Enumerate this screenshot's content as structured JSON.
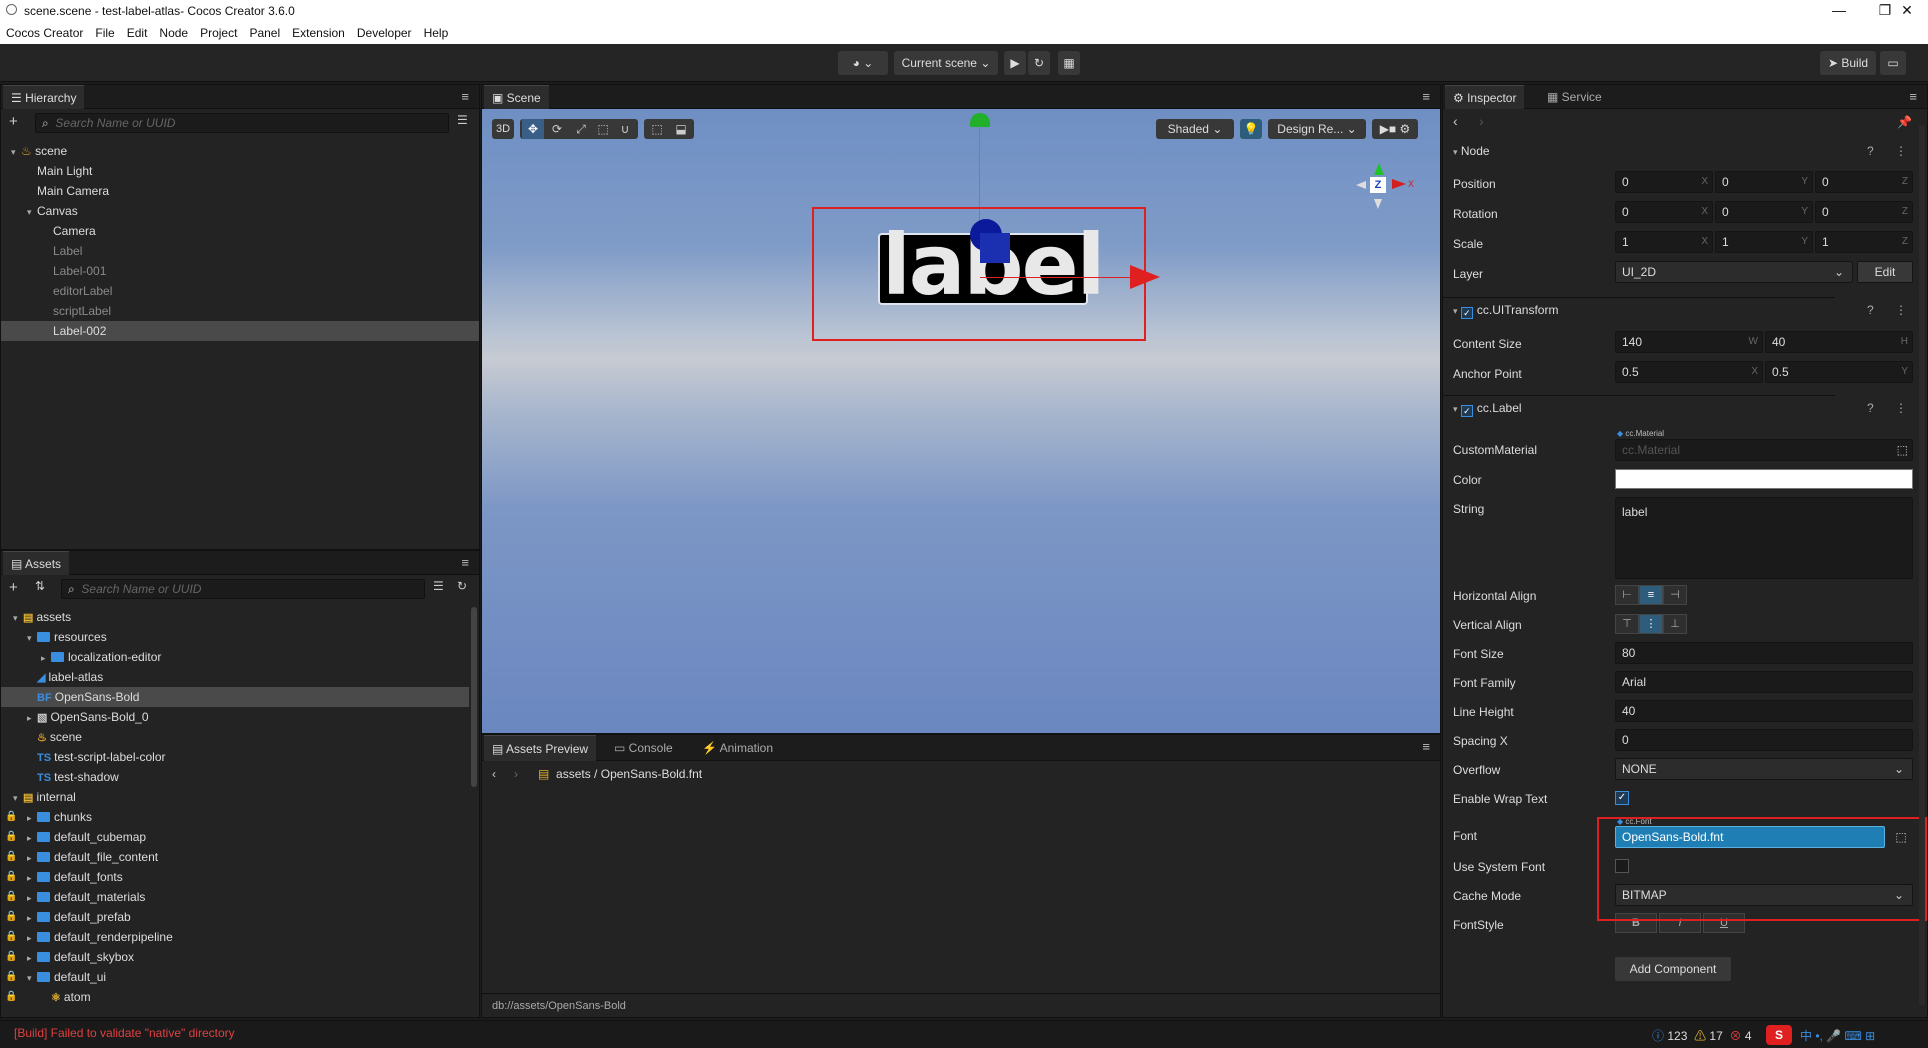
{
  "window": {
    "title": "scene.scene - test-label-atlas- Cocos Creator 3.6.0"
  },
  "menu": [
    "Cocos Creator",
    "File",
    "Edit",
    "Node",
    "Project",
    "Panel",
    "Extension",
    "Developer",
    "Help"
  ],
  "toolbar": {
    "scene_select": "Current scene",
    "build": "Build"
  },
  "hierarchy": {
    "tab": "Hierarchy",
    "search_placeholder": "Search Name or UUID",
    "items": [
      {
        "label": "scene",
        "depth": 0,
        "arrow": "open",
        "icon": "fire",
        "dim": false,
        "sel": false
      },
      {
        "label": "Main Light",
        "depth": 1,
        "arrow": "",
        "icon": "",
        "dim": false,
        "sel": false
      },
      {
        "label": "Main Camera",
        "depth": 1,
        "arrow": "",
        "icon": "",
        "dim": false,
        "sel": false
      },
      {
        "label": "Canvas",
        "depth": 1,
        "arrow": "open",
        "icon": "",
        "dim": false,
        "sel": false
      },
      {
        "label": "Camera",
        "depth": 2,
        "arrow": "",
        "icon": "",
        "dim": false,
        "sel": false
      },
      {
        "label": "Label",
        "depth": 2,
        "arrow": "",
        "icon": "",
        "dim": true,
        "sel": false
      },
      {
        "label": "Label-001",
        "depth": 2,
        "arrow": "",
        "icon": "",
        "dim": true,
        "sel": false
      },
      {
        "label": "editorLabel",
        "depth": 2,
        "arrow": "",
        "icon": "",
        "dim": true,
        "sel": false
      },
      {
        "label": "scriptLabel",
        "depth": 2,
        "arrow": "",
        "icon": "",
        "dim": true,
        "sel": false
      },
      {
        "label": "Label-002",
        "depth": 2,
        "arrow": "",
        "icon": "",
        "dim": false,
        "sel": true
      }
    ]
  },
  "assets": {
    "tab": "Assets",
    "search_placeholder": "Search Name or UUID",
    "items": [
      {
        "label": "assets",
        "depth": 0,
        "arrow": "open",
        "icon": "db",
        "lock": false,
        "sel": false
      },
      {
        "label": "resources",
        "depth": 1,
        "arrow": "open",
        "icon": "folder",
        "lock": false,
        "sel": false
      },
      {
        "label": "localization-editor",
        "depth": 2,
        "arrow": "closed",
        "icon": "folder",
        "lock": false,
        "sel": false
      },
      {
        "label": "label-atlas",
        "depth": 1,
        "arrow": "",
        "icon": "labelatlas",
        "lock": false,
        "sel": false
      },
      {
        "label": "OpenSans-Bold",
        "depth": 1,
        "arrow": "",
        "icon": "bf",
        "lock": false,
        "sel": true
      },
      {
        "label": "OpenSans-Bold_0",
        "depth": 1,
        "arrow": "closed",
        "icon": "img",
        "lock": false,
        "sel": false
      },
      {
        "label": "scene",
        "depth": 1,
        "arrow": "",
        "icon": "fire",
        "lock": false,
        "sel": false
      },
      {
        "label": "test-script-label-color",
        "depth": 1,
        "arrow": "",
        "icon": "ts",
        "lock": false,
        "sel": false
      },
      {
        "label": "test-shadow",
        "depth": 1,
        "arrow": "",
        "icon": "ts",
        "lock": false,
        "sel": false
      },
      {
        "label": "internal",
        "depth": 0,
        "arrow": "open",
        "icon": "db",
        "lock": false,
        "sel": false
      },
      {
        "label": "chunks",
        "depth": 1,
        "arrow": "closed",
        "icon": "folder",
        "lock": true,
        "sel": false
      },
      {
        "label": "default_cubemap",
        "depth": 1,
        "arrow": "closed",
        "icon": "folder",
        "lock": true,
        "sel": false
      },
      {
        "label": "default_file_content",
        "depth": 1,
        "arrow": "closed",
        "icon": "folder",
        "lock": true,
        "sel": false
      },
      {
        "label": "default_fonts",
        "depth": 1,
        "arrow": "closed",
        "icon": "folder",
        "lock": true,
        "sel": false
      },
      {
        "label": "default_materials",
        "depth": 1,
        "arrow": "closed",
        "icon": "folder",
        "lock": true,
        "sel": false
      },
      {
        "label": "default_prefab",
        "depth": 1,
        "arrow": "closed",
        "icon": "folder",
        "lock": true,
        "sel": false
      },
      {
        "label": "default_renderpipeline",
        "depth": 1,
        "arrow": "closed",
        "icon": "folder",
        "lock": true,
        "sel": false
      },
      {
        "label": "default_skybox",
        "depth": 1,
        "arrow": "closed",
        "icon": "folder",
        "lock": true,
        "sel": false
      },
      {
        "label": "default_ui",
        "depth": 1,
        "arrow": "open",
        "icon": "folder",
        "lock": true,
        "sel": false
      },
      {
        "label": "atom",
        "depth": 2,
        "arrow": "",
        "icon": "atom",
        "lock": true,
        "sel": false
      }
    ]
  },
  "scene": {
    "tab": "Scene",
    "mode3d": "3D",
    "shading": "Shaded",
    "design": "Design Re...",
    "label_text": "label",
    "gizmo_z": "Z"
  },
  "bottom": {
    "tabs": [
      "Assets Preview",
      "Console",
      "Animation"
    ],
    "breadcrumb_root": "assets",
    "breadcrumb_sep": "/",
    "breadcrumb_file": "OpenSans-Bold.fnt",
    "footer": "db://assets/OpenSans-Bold"
  },
  "inspector": {
    "tabs": [
      "Inspector",
      "Service"
    ],
    "node": {
      "title": "Node",
      "position": [
        "0",
        "0",
        "0"
      ],
      "rotation": [
        "0",
        "0",
        "0"
      ],
      "scale": [
        "1",
        "1",
        "1"
      ],
      "layer": "UI_2D",
      "edit": "Edit",
      "labels": {
        "position": "Position",
        "rotation": "Rotation",
        "scale": "Scale",
        "layer": "Layer"
      }
    },
    "axes": {
      "x": "X",
      "y": "Y",
      "z": "Z",
      "w": "W",
      "h": "H"
    },
    "uitransform": {
      "title": "cc.UITransform",
      "content_label": "Content Size",
      "content": [
        "140",
        "40"
      ],
      "anchor_label": "Anchor Point",
      "anchor": [
        "0.5",
        "0.5"
      ]
    },
    "label": {
      "title": "cc.Label",
      "custom_material_label": "CustomMaterial",
      "material_tag": "cc.Material",
      "material_placeholder": "cc.Material",
      "color_label": "Color",
      "string_label": "String",
      "string_value": "label",
      "halign_label": "Horizontal Align",
      "valign_label": "Vertical Align",
      "font_size_label": "Font Size",
      "font_size": "80",
      "font_family_label": "Font Family",
      "font_family": "Arial",
      "line_height_label": "Line Height",
      "line_height": "40",
      "spacing_label": "Spacing X",
      "spacing": "0",
      "overflow_label": "Overflow",
      "overflow": "NONE",
      "wrap_label": "Enable Wrap Text",
      "font_label": "Font",
      "font_tag": "cc.Font",
      "font_value": "OpenSans-Bold.fnt",
      "sysfont_label": "Use System Font",
      "cache_label": "Cache Mode",
      "cache": "BITMAP",
      "fontstyle_label": "FontStyle",
      "style_b": "B",
      "style_i": "I",
      "style_u": "U"
    },
    "add_component": "Add Component"
  },
  "status": {
    "error": "[Build] Failed to validate \"native\" directory",
    "info_count": "123",
    "warn_count": "17",
    "err_count": "4"
  },
  "colors": {
    "highlight_box": "#e02020",
    "accent": "#3a8ee0",
    "font_field": "#1f7fb5"
  }
}
